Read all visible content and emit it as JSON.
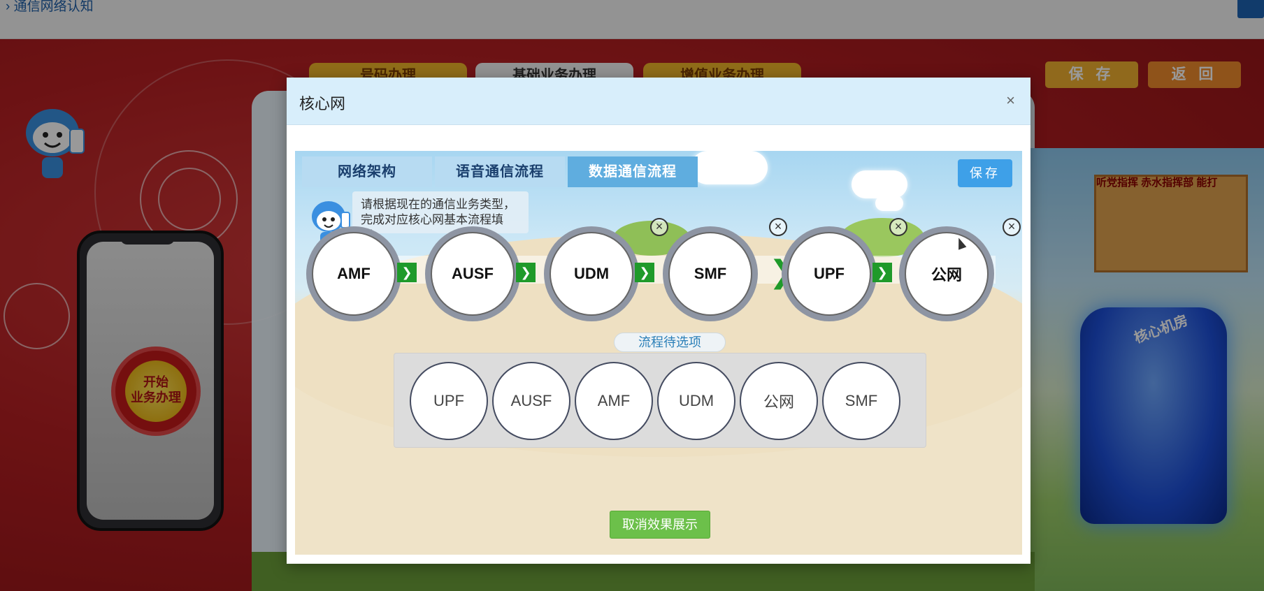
{
  "app": {
    "title": "通信网络认知"
  },
  "background": {
    "nav_tabs": [
      "号码办理",
      "基础业务办理",
      "增值业务办理"
    ],
    "save_label": "保 存",
    "back_label": "返 回",
    "start_button_label": "开始\n业务办理",
    "building_sign": "听党指挥  赤水指挥部  能打",
    "tower_label": "核心机房"
  },
  "modal": {
    "title": "核心网",
    "close_icon": "×",
    "tabs": [
      {
        "label": "网络架构",
        "active": false
      },
      {
        "label": "语音通信流程",
        "active": false
      },
      {
        "label": "数据通信流程",
        "active": true
      }
    ],
    "save_label": "保存",
    "tip": "请根据现在的通信业务类型，完成对应核心网基本流程填写。",
    "flow_nodes": [
      "AMF",
      "AUSF",
      "UDM",
      "SMF",
      "UPF",
      "公网"
    ],
    "arrow_glyph": "❯",
    "remove_glyph": "×",
    "pending_label": "流程待选项",
    "pending_options": [
      "UPF",
      "AUSF",
      "AMF",
      "UDM",
      "公网",
      "SMF"
    ],
    "cancel_label": "取消效果展示"
  },
  "colors": {
    "accent_blue": "#3ea0e8",
    "active_tab": "#5faddf",
    "arrow_green": "#1f9a2a",
    "cancel_green": "#6cc04a"
  }
}
